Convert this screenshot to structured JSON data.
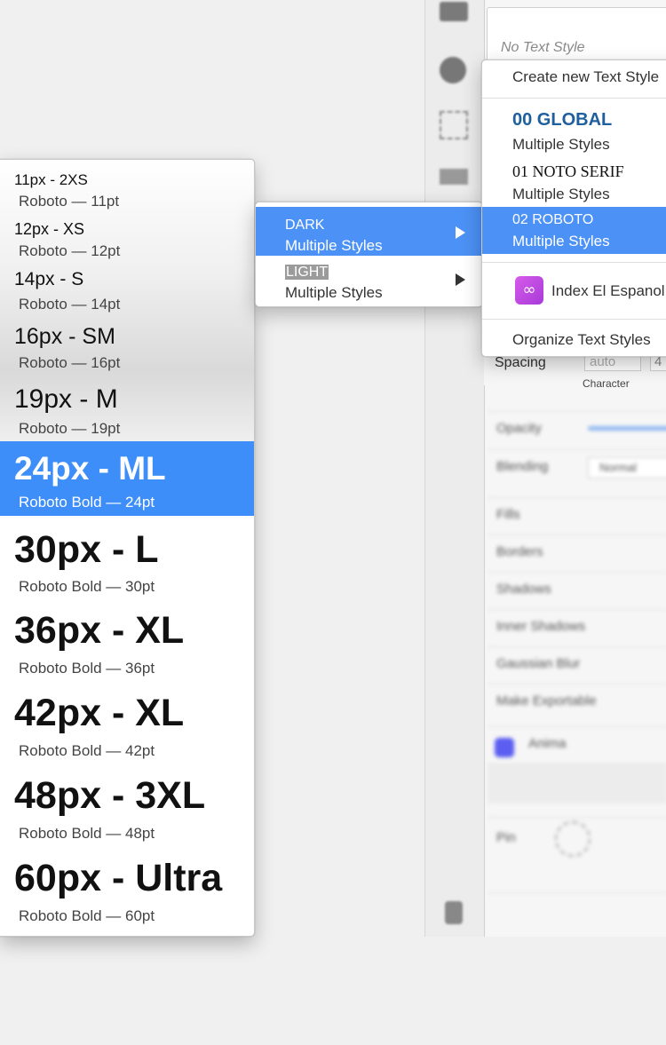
{
  "inspector": {
    "style_placeholder": "No Text Style",
    "spacing_label": "Spacing",
    "spacing_value": "auto",
    "spacing_value2": "4",
    "character_label": "Character",
    "rows": [
      "Opacity",
      "Blending",
      "Fills",
      "Borders",
      "Shadows",
      "Inner Shadows",
      "Gaussian Blur",
      "Make Exportable",
      "Anima",
      "Pin"
    ],
    "blending_value": "Normal"
  },
  "styles_menu": {
    "items": [
      {
        "title": "11px - 2XS",
        "sub": "Roboto — 11pt"
      },
      {
        "title": "12px - XS",
        "sub": "Roboto — 12pt"
      },
      {
        "title": "14px - S",
        "sub": "Roboto — 14pt"
      },
      {
        "title": "16px - SM",
        "sub": "Roboto — 16pt"
      },
      {
        "title": "19px - M",
        "sub": "Roboto — 19pt"
      },
      {
        "title": "24px - ML",
        "sub": "Roboto Bold — 24pt"
      },
      {
        "title": "30px - L",
        "sub": "Roboto Bold — 30pt"
      },
      {
        "title": "36px - XL",
        "sub": "Roboto Bold — 36pt"
      },
      {
        "title": "42px - XL",
        "sub": "Roboto Bold — 42pt"
      },
      {
        "title": "48px - 3XL",
        "sub": "Roboto Bold — 48pt"
      },
      {
        "title": "60px - Ultra",
        "sub": "Roboto Bold — 60pt"
      }
    ],
    "selected": "24px - ML"
  },
  "theme_menu": {
    "items": [
      {
        "title": "DARK",
        "sub": "Multiple Styles"
      },
      {
        "title": "LIGHT",
        "sub": "Multiple Styles"
      }
    ]
  },
  "text_styles_menu": {
    "create": "Create new Text Style",
    "groups": [
      {
        "title": "00 GLOBAL",
        "sub": "Multiple Styles"
      },
      {
        "title": "01 NOTO SERIF",
        "sub": "Multiple Styles"
      },
      {
        "title": "02 ROBOTO",
        "sub": "Multiple Styles"
      }
    ],
    "plugin": "Index El Espanol",
    "organize": "Organize Text Styles"
  },
  "colors": {
    "selection": "#3d8ef8",
    "global_title": "#1f5f9e",
    "plugin_icon": "#c04ee3"
  }
}
